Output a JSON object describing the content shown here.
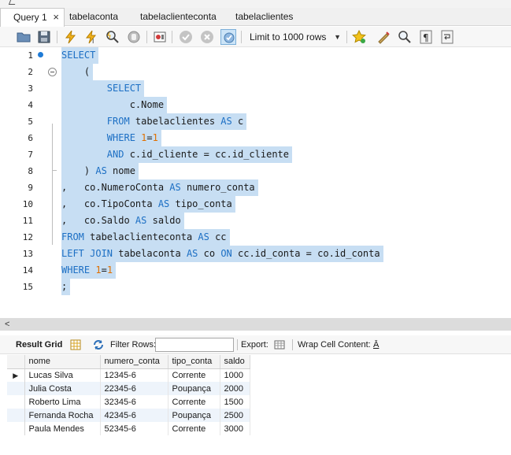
{
  "tabs": [
    {
      "label": "Query 1",
      "active": true
    },
    {
      "label": "tabelaconta",
      "active": false
    },
    {
      "label": "tabelaclienteconta",
      "active": false
    },
    {
      "label": "tabelaclientes",
      "active": false
    }
  ],
  "tab_close_glyph": "×",
  "toolbar": {
    "icons": [
      "open-folder-icon",
      "save-icon",
      "execute-icon",
      "execute-current-icon",
      "explain-icon",
      "stop-icon",
      "toggle-output-icon",
      "commit-icon",
      "rollback-icon",
      "autocommit-icon",
      "favorite-add-icon",
      "beautify-icon",
      "find-icon",
      "invisible-chars-icon",
      "wrap-icon"
    ],
    "limit_label": "Limit to 1000 rows",
    "limit_caret": "▼"
  },
  "editor": {
    "lines": [
      {
        "n": "1",
        "tokens": [
          [
            "kw",
            "SELECT"
          ]
        ]
      },
      {
        "n": "2",
        "tokens": [
          [
            "t",
            "    ("
          ]
        ]
      },
      {
        "n": "3",
        "tokens": [
          [
            "t",
            "        "
          ],
          [
            "kw",
            "SELECT"
          ]
        ]
      },
      {
        "n": "4",
        "tokens": [
          [
            "t",
            "            c.Nome"
          ]
        ]
      },
      {
        "n": "5",
        "tokens": [
          [
            "t",
            "        "
          ],
          [
            "kw",
            "FROM"
          ],
          [
            "t",
            " tabelaclientes "
          ],
          [
            "kw",
            "AS"
          ],
          [
            "t",
            " c"
          ]
        ]
      },
      {
        "n": "6",
        "tokens": [
          [
            "t",
            "        "
          ],
          [
            "kw",
            "WHERE"
          ],
          [
            "t",
            " "
          ],
          [
            "num",
            "1"
          ],
          [
            "t",
            "="
          ],
          [
            "num",
            "1"
          ]
        ]
      },
      {
        "n": "7",
        "tokens": [
          [
            "t",
            "        "
          ],
          [
            "kw",
            "AND"
          ],
          [
            "t",
            " c.id_cliente = cc.id_cliente"
          ]
        ]
      },
      {
        "n": "8",
        "tokens": [
          [
            "t",
            "    ) "
          ],
          [
            "kw",
            "AS"
          ],
          [
            "t",
            " nome"
          ]
        ]
      },
      {
        "n": "9",
        "tokens": [
          [
            "t",
            ",   co.NumeroConta "
          ],
          [
            "kw",
            "AS"
          ],
          [
            "t",
            " numero_conta"
          ]
        ]
      },
      {
        "n": "10",
        "tokens": [
          [
            "t",
            ",   co.TipoConta "
          ],
          [
            "kw",
            "AS"
          ],
          [
            "t",
            " tipo_conta"
          ]
        ]
      },
      {
        "n": "11",
        "tokens": [
          [
            "t",
            ",   co.Saldo "
          ],
          [
            "kw",
            "AS"
          ],
          [
            "t",
            " saldo"
          ]
        ]
      },
      {
        "n": "12",
        "tokens": [
          [
            "kw",
            "FROM"
          ],
          [
            "t",
            " tabelaclienteconta "
          ],
          [
            "kw",
            "AS"
          ],
          [
            "t",
            " cc"
          ]
        ]
      },
      {
        "n": "13",
        "tokens": [
          [
            "kw",
            "LEFT JOIN"
          ],
          [
            "t",
            " tabelaconta "
          ],
          [
            "kw",
            "AS"
          ],
          [
            "t",
            " co "
          ],
          [
            "kw",
            "ON"
          ],
          [
            "t",
            " cc.id_conta = co.id_conta"
          ]
        ]
      },
      {
        "n": "14",
        "tokens": [
          [
            "kw",
            "WHERE"
          ],
          [
            "t",
            " "
          ],
          [
            "num",
            "1"
          ],
          [
            "t",
            "="
          ],
          [
            "num",
            "1"
          ]
        ]
      },
      {
        "n": "15",
        "tokens": [
          [
            "t",
            ";"
          ]
        ]
      }
    ]
  },
  "scroll_left_glyph": "<",
  "results_toolbar": {
    "result_grid_label": "Result Grid",
    "filter_label": "Filter Rows:",
    "filter_value": "",
    "export_label": "Export:",
    "wrap_label": "Wrap Cell Content:",
    "wrap_glyph": "Ā"
  },
  "grid": {
    "columns": [
      "nome",
      "numero_conta",
      "tipo_conta",
      "saldo"
    ],
    "current_row_marker": "▶",
    "rows": [
      [
        "Lucas Silva",
        "12345-6",
        "Corrente",
        "1000"
      ],
      [
        "Julia Costa",
        "22345-6",
        "Poupança",
        "2000"
      ],
      [
        "Roberto Lima",
        "32345-6",
        "Corrente",
        "1500"
      ],
      [
        "Fernanda Rocha",
        "42345-6",
        "Poupança",
        "2500"
      ],
      [
        "Paula Mendes",
        "52345-6",
        "Corrente",
        "3000"
      ]
    ]
  },
  "colors": {
    "selection": "#c7def3",
    "keyword": "#1c6fc4",
    "number": "#e07000",
    "marker": "#1f7bd6"
  }
}
